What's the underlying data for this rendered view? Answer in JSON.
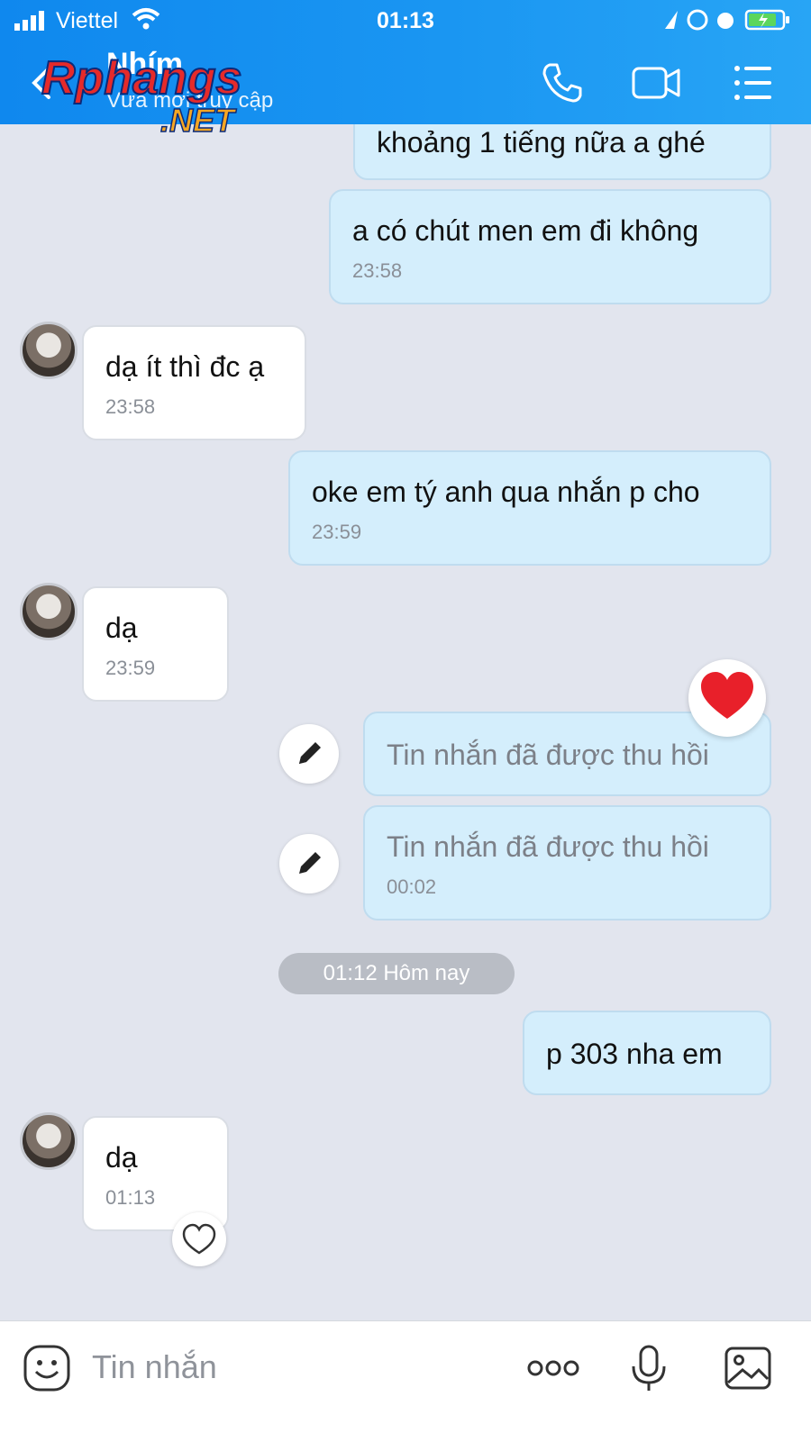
{
  "status_bar": {
    "carrier": "Viettel",
    "time": "01:13"
  },
  "header": {
    "contact_name": "Nhím",
    "contact_status": "Vừa mới truy cập",
    "watermark": "Rphangs .NET"
  },
  "messages": [
    {
      "dir": "out",
      "text": "khoảng 1 tiếng nữa a ghé",
      "time": ""
    },
    {
      "dir": "out",
      "text": "a có chút men em đi không",
      "time": "23:58"
    },
    {
      "dir": "in",
      "text": "dạ ít thì đc ạ",
      "time": "23:58"
    },
    {
      "dir": "out",
      "text": "oke em tý anh qua nhắn p cho",
      "time": "23:59"
    },
    {
      "dir": "in",
      "text": "dạ",
      "time": "23:59"
    },
    {
      "dir": "out",
      "text": "Tin nhắn đã được thu hồi",
      "time": "",
      "recalled": true,
      "reaction": "heart"
    },
    {
      "dir": "out",
      "text": "Tin nhắn đã được thu hồi",
      "time": "00:02",
      "recalled": true
    },
    {
      "dir": "out",
      "text": "p 303 nha em",
      "time": ""
    },
    {
      "dir": "in",
      "text": "dạ",
      "time": "01:13"
    }
  ],
  "date_divider": "01:12 Hôm nay",
  "composer": {
    "placeholder": "Tin nhắn"
  },
  "colors": {
    "header": "#1a96f2",
    "outgoing_bubble": "#d4eefc",
    "chat_bg": "#e2e5ee"
  }
}
